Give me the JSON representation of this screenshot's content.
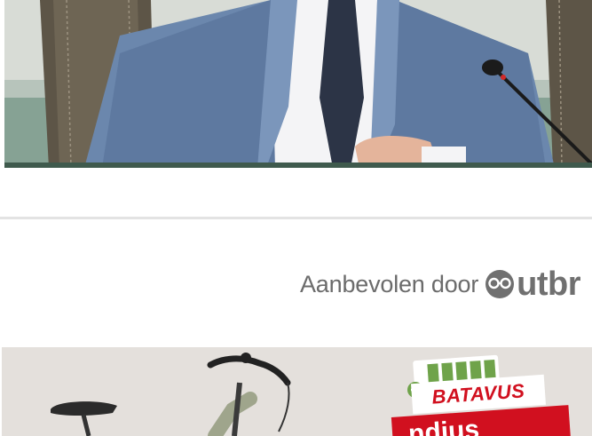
{
  "hero": {
    "alt_subject": "man-in-blue-suit-at-microphone"
  },
  "recommendation": {
    "label": "Aanbevolen door",
    "brand": "Outbrain",
    "brand_visible": "utbr",
    "brand_color": "#707070",
    "label_color": "#6b6b6b"
  },
  "ad": {
    "brand": "BATAVUS",
    "promo_partial": "ndius",
    "brand_color": "#d1101f",
    "battery_color": "#6fa34a"
  },
  "colors": {
    "separator": "#e3e3e3",
    "background": "#ffffff"
  }
}
